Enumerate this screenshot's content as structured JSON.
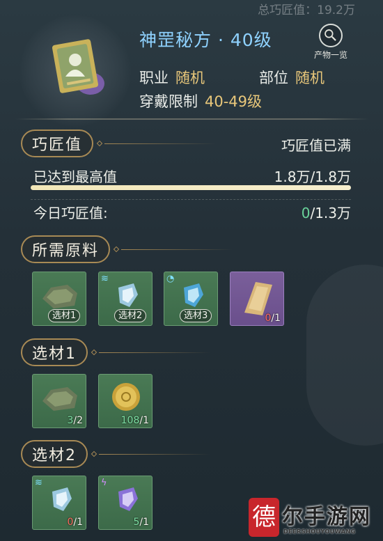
{
  "header": {
    "top_faded_text": "总巧匠值：19.2万",
    "title": "神罡秘方 · 40级",
    "catalog_label": "产物一览",
    "attrs": {
      "profession_key": "职业",
      "profession_value": "随机",
      "slot_key": "部位",
      "slot_value": "随机",
      "limit_key": "穿戴限制",
      "limit_value": "40-49级"
    }
  },
  "craft": {
    "section_title": "巧匠值",
    "status": "巧匠值已满",
    "max_label": "已达到最高值",
    "max_value": "1.8万/1.8万",
    "progress_fraction": 1.0,
    "today_label": "今日巧匠值:",
    "today_current": "0",
    "today_total": "/1.3万"
  },
  "materials": {
    "section_title": "所需原料",
    "items": [
      {
        "name": "stone-material",
        "badge": "选材1"
      },
      {
        "name": "crystal-material",
        "badge": "选材2"
      },
      {
        "name": "crystal-blue-material",
        "badge": "选材3"
      },
      {
        "name": "scroll-material",
        "count_have": "0",
        "count_need": "/1"
      }
    ]
  },
  "choice1": {
    "section_title": "选材1",
    "items": [
      {
        "name": "stone-material",
        "count_have": "3",
        "count_need": "/2"
      },
      {
        "name": "coin-material",
        "count_have": "108",
        "count_need": "/1"
      }
    ]
  },
  "choice2": {
    "section_title": "选材2",
    "items": [
      {
        "name": "crystal-material",
        "count_have": "0",
        "count_need": "/1"
      },
      {
        "name": "crystal-purple-material",
        "count_have": "5",
        "count_need": "/1"
      }
    ]
  },
  "watermark": {
    "seal": "德",
    "name": "尔手游网",
    "sub": "DEERSHOUYOUWANG"
  },
  "colors": {
    "title_blue": "#8fd2ff",
    "value_gold": "#e8c77a",
    "accent_green": "#6ad39b",
    "slot_green": "#4a7a55",
    "slot_purple": "#7a5f9a"
  }
}
